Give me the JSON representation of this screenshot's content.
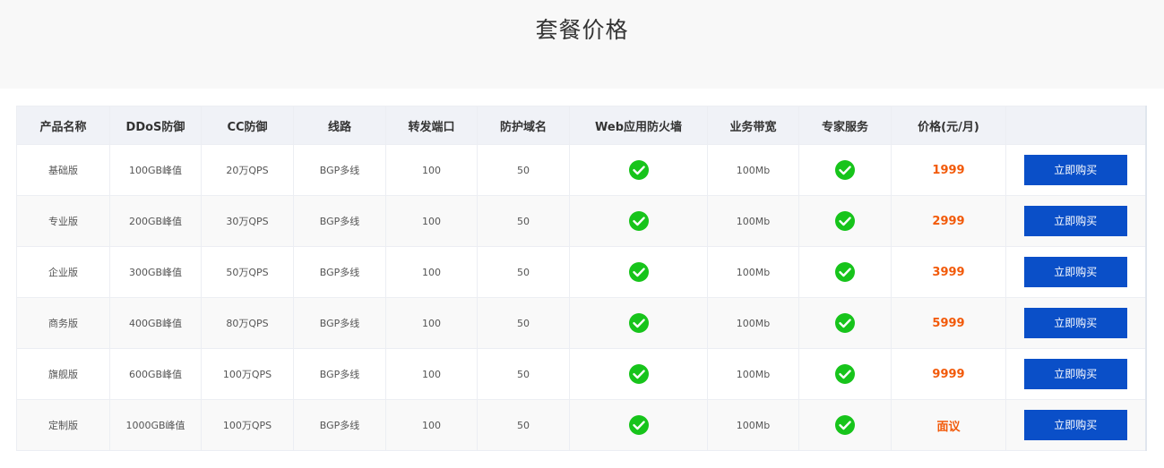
{
  "page": {
    "title": "套餐价格"
  },
  "table": {
    "headers": [
      "产品名称",
      "DDoS防御",
      "CC防御",
      "线路",
      "转发端口",
      "防护域名",
      "Web应用防火墙",
      "业务带宽",
      "专家服务",
      "价格(元/月)",
      ""
    ],
    "rows": [
      {
        "name": "基础版",
        "ddos": "100GB峰值",
        "cc": "20万QPS",
        "line": "BGP多线",
        "ports": "100",
        "domains": "50",
        "waf": "check-icon",
        "bandwidth": "100Mb",
        "expert": "check-icon",
        "price": "1999",
        "action": "立即购买"
      },
      {
        "name": "专业版",
        "ddos": "200GB峰值",
        "cc": "30万QPS",
        "line": "BGP多线",
        "ports": "100",
        "domains": "50",
        "waf": "check-icon",
        "bandwidth": "100Mb",
        "expert": "check-icon",
        "price": "2999",
        "action": "立即购买"
      },
      {
        "name": "企业版",
        "ddos": "300GB峰值",
        "cc": "50万QPS",
        "line": "BGP多线",
        "ports": "100",
        "domains": "50",
        "waf": "check-icon",
        "bandwidth": "100Mb",
        "expert": "check-icon",
        "price": "3999",
        "action": "立即购买"
      },
      {
        "name": "商务版",
        "ddos": "400GB峰值",
        "cc": "80万QPS",
        "line": "BGP多线",
        "ports": "100",
        "domains": "50",
        "waf": "check-icon",
        "bandwidth": "100Mb",
        "expert": "check-icon",
        "price": "5999",
        "action": "立即购买"
      },
      {
        "name": "旗舰版",
        "ddos": "600GB峰值",
        "cc": "100万QPS",
        "line": "BGP多线",
        "ports": "100",
        "domains": "50",
        "waf": "check-icon",
        "bandwidth": "100Mb",
        "expert": "check-icon",
        "price": "9999",
        "action": "立即购买"
      },
      {
        "name": "定制版",
        "ddos": "1000GB峰值",
        "cc": "100万QPS",
        "line": "BGP多线",
        "ports": "100",
        "domains": "50",
        "waf": "check-icon",
        "bandwidth": "100Mb",
        "expert": "check-icon",
        "price": "面议",
        "action": "立即购买"
      }
    ]
  },
  "colors": {
    "price": "#f25a0a",
    "button": "#0a4fc8",
    "check": "#17c41b",
    "header_bg": "#f0f2f7"
  }
}
